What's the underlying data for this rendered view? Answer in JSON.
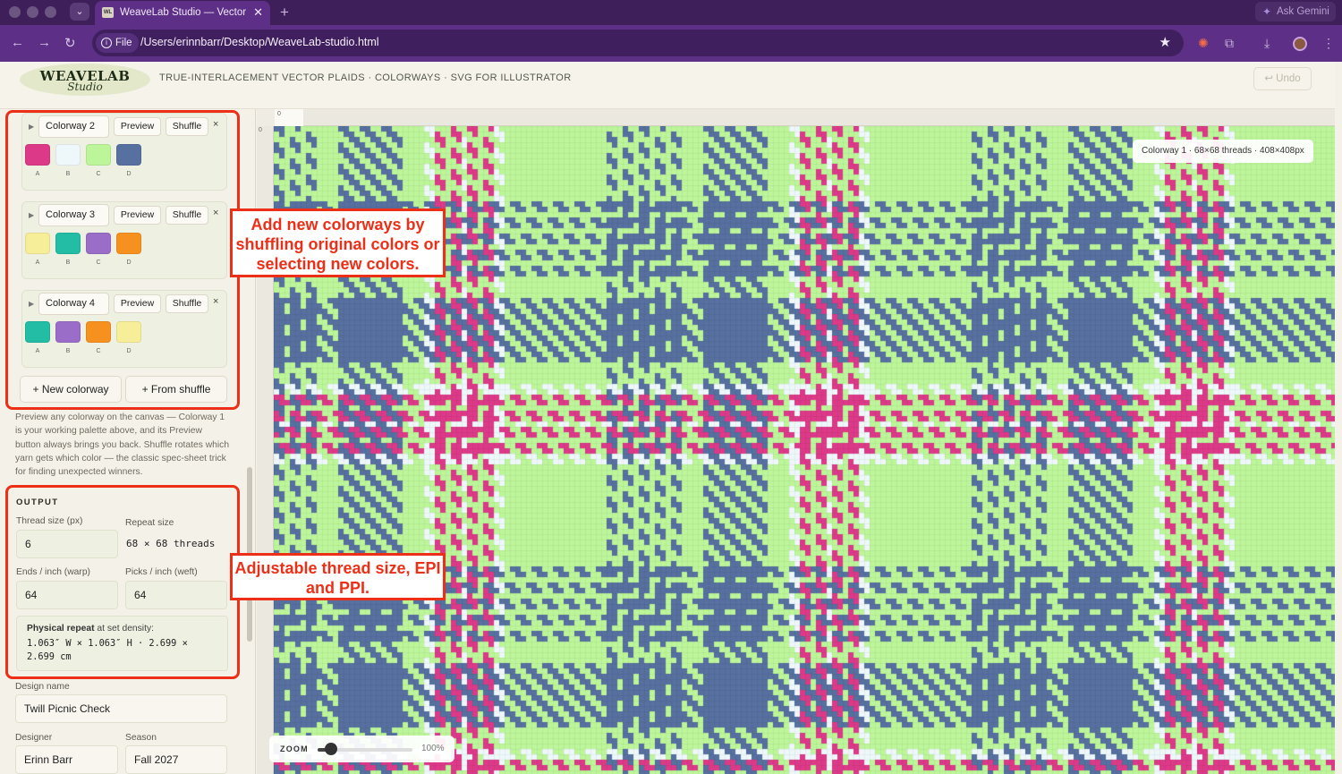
{
  "browser": {
    "tab_title": "WeaveLab Studio — Vector Pl",
    "favicon_text": "WL",
    "url_chip": "File",
    "url": "/Users/erinnbarr/Desktop/WeaveLab-studio.html",
    "gemini_label": "Ask Gemini",
    "icons": [
      "back-icon",
      "forward-icon",
      "reload-icon",
      "info-icon",
      "bookmark-star-icon",
      "extension-icon",
      "puzzle-icon",
      "download-icon",
      "profile-icon",
      "menu-icon"
    ]
  },
  "header": {
    "logo_main": "WEAVELAB",
    "logo_sub": "Studio",
    "tagline": "TRUE-INTERLACEMENT VECTOR PLAIDS · COLORWAYS · SVG FOR ILLUSTRATOR",
    "undo_label": "↩ Undo"
  },
  "colorways": [
    {
      "name": "Colorway 2",
      "preview": "Preview",
      "shuffle": "Shuffle",
      "remove": "×",
      "swatches": [
        {
          "label": "A",
          "color": "#dc3a88"
        },
        {
          "label": "B",
          "color": "#eef7fa"
        },
        {
          "label": "C",
          "color": "#bdf59b"
        },
        {
          "label": "D",
          "color": "#56709f"
        }
      ]
    },
    {
      "name": "Colorway 3",
      "preview": "Preview",
      "shuffle": "Shuffle",
      "remove": "×",
      "swatches": [
        {
          "label": "A",
          "color": "#f6ee98"
        },
        {
          "label": "B",
          "color": "#23bca5"
        },
        {
          "label": "C",
          "color": "#9a6ec8"
        },
        {
          "label": "D",
          "color": "#f69120"
        }
      ]
    },
    {
      "name": "Colorway 4",
      "preview": "Preview",
      "shuffle": "Shuffle",
      "remove": "×",
      "swatches": [
        {
          "label": "A",
          "color": "#23bca5"
        },
        {
          "label": "B",
          "color": "#9a6ec8"
        },
        {
          "label": "C",
          "color": "#f69120"
        },
        {
          "label": "D",
          "color": "#f6ee98"
        }
      ]
    }
  ],
  "add_buttons": {
    "new": "+ New colorway",
    "shuffle": "+ From shuffle"
  },
  "help_text": "Preview any colorway on the canvas — Colorway 1 is your working palette above, and its Preview button always brings you back. Shuffle rotates which yarn gets which color — the classic spec-sheet trick for finding unexpected winners.",
  "callouts": {
    "colorways": "Add new colorways by shuffling original colors or selecting new colors.",
    "output": "Adjustable thread size, EPI and PPI."
  },
  "output": {
    "title": "OUTPUT",
    "thread_size_label": "Thread size (px)",
    "thread_size": "6",
    "repeat_label": "Repeat size",
    "repeat_value": "68 × 68 threads",
    "epi_label": "Ends / inch (warp)",
    "epi": "64",
    "ppi_label": "Picks / inch (weft)",
    "ppi": "64",
    "physical_label_bold": "Physical repeat",
    "physical_label_rest": " at set density:",
    "physical_value": "1.063″ W × 1.063″ H · 2.699 × 2.699 cm"
  },
  "design": {
    "name_label": "Design name",
    "name": "Twill Picnic Check",
    "designer_label": "Designer",
    "designer": "Erinn Barr",
    "season_label": "Season",
    "season": "Fall 2027"
  },
  "canvas": {
    "ruler_top_label": "0",
    "ruler_left_label": "0",
    "info": "Colorway 1 · 68×68 threads · 408×408px",
    "zoom_label": "ZOOM",
    "zoom_value": "100%",
    "zoom_fraction": 0.14,
    "colors": {
      "pink": "#dc3a88",
      "white": "#eef7fa",
      "green": "#bdf59b",
      "blue": "#56709f"
    }
  }
}
